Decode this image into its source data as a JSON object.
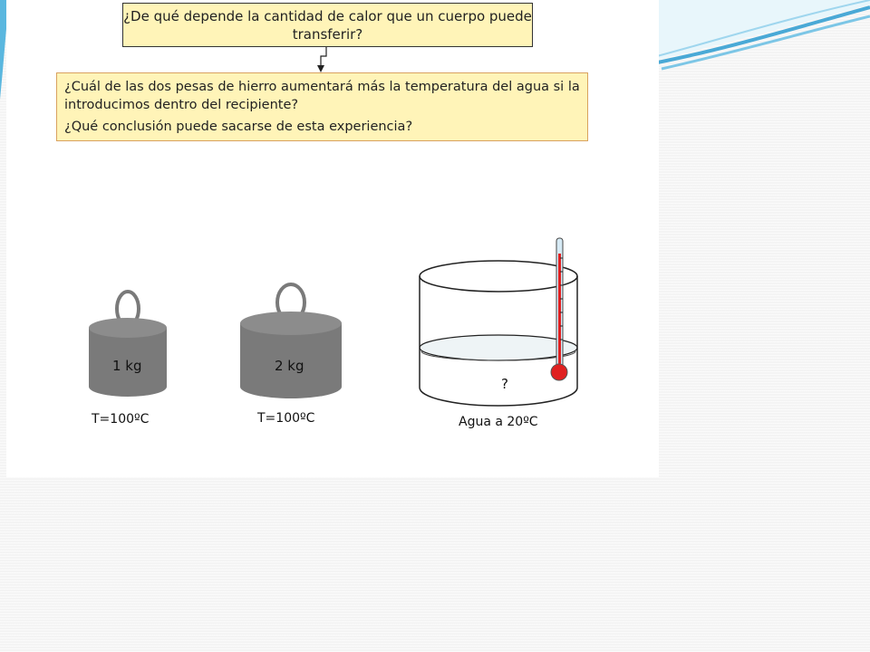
{
  "question_main": "¿De qué depende la cantidad de calor que un cuerpo puede transferir?",
  "question_sub": {
    "line1": "¿Cuál de las dos pesas de hierro aumentará más la temperatura del agua si la introducimos dentro del recipiente?",
    "line2": "¿Qué conclusión puede sacarse de esta experiencia?"
  },
  "weights": [
    {
      "mass_label": "1 kg",
      "temp_label": "T=100ºC"
    },
    {
      "mass_label": "2 kg",
      "temp_label": "T=100ºC"
    }
  ],
  "container": {
    "question_mark": "?",
    "water_label": "Agua a 20ºC"
  },
  "colors": {
    "box_fill": "#fff4b8",
    "weight_gray": "#7a7a7a",
    "thermo_red": "#e02020"
  }
}
